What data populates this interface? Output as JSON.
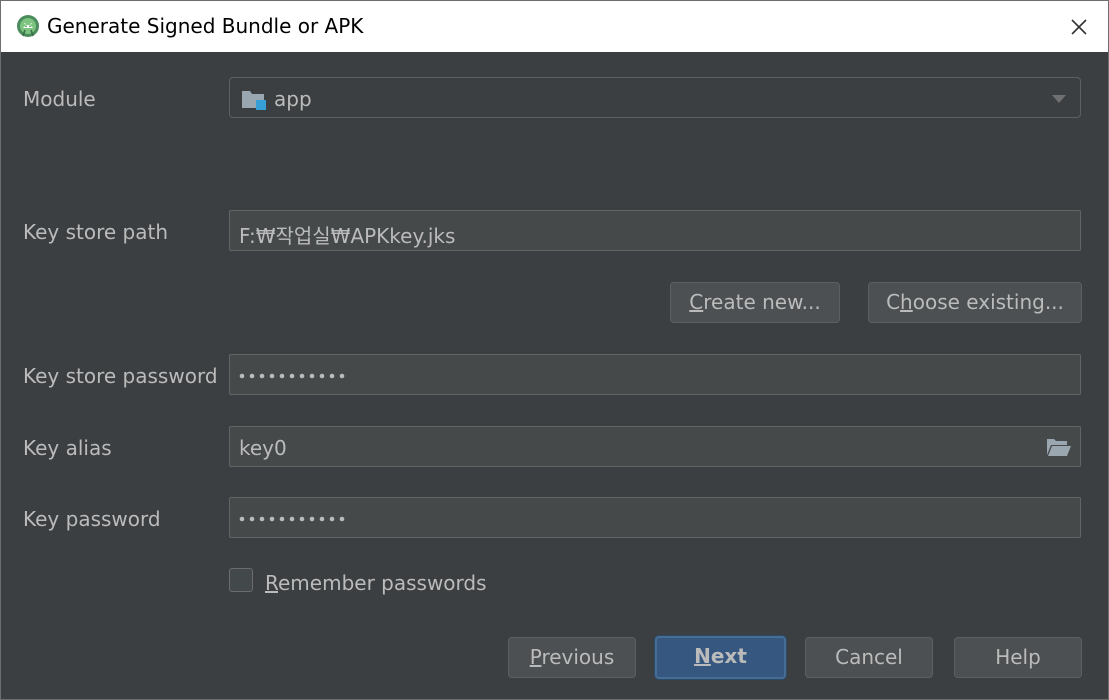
{
  "window": {
    "title": "Generate Signed Bundle or APK"
  },
  "icons": {
    "app": "android-studio-icon",
    "close": "close-icon",
    "module": "module-folder-icon",
    "dropdown": "chevron-down-icon",
    "browse": "folder-open-icon"
  },
  "colors": {
    "background": "#3c3f41",
    "field_bg": "#45494a",
    "text": "#bbbbbb",
    "accent_button": "#365880"
  },
  "form": {
    "module": {
      "label": "Module",
      "value": "app"
    },
    "key_store_path": {
      "label": "Key store path",
      "value": "F:₩작업실₩APKkey.jks"
    },
    "buttons": {
      "create_new": {
        "mnemonic": "C",
        "rest": "reate new..."
      },
      "choose_existing": {
        "before": "C",
        "mnemonic": "h",
        "rest": "oose existing..."
      }
    },
    "key_store_password": {
      "label": "Key store password",
      "masked": "•••••••••••"
    },
    "key_alias": {
      "label": "Key alias",
      "value": "key0"
    },
    "key_password": {
      "label": "Key password",
      "masked": "•••••••••••"
    },
    "remember": {
      "mnemonic": "R",
      "rest": "emember passwords",
      "checked": false
    }
  },
  "footer": {
    "previous": {
      "mnemonic": "P",
      "rest": "revious"
    },
    "next": {
      "mnemonic": "N",
      "rest": "ext"
    },
    "cancel": "Cancel",
    "help": "Help"
  }
}
